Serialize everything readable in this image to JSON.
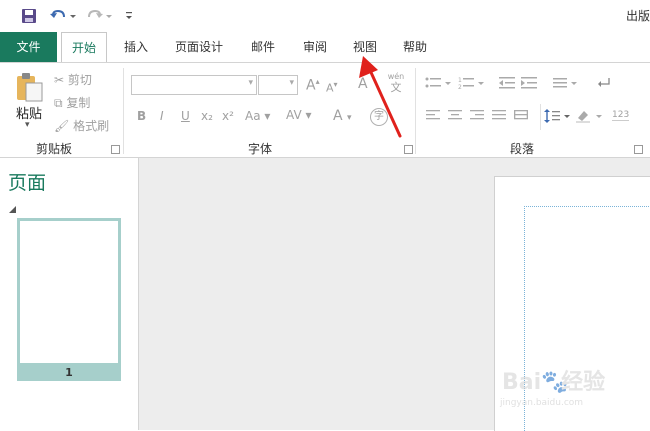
{
  "app": {
    "title_partial": "出版"
  },
  "quick_access": {
    "save_icon": "save-icon",
    "undo_icon": "undo-icon",
    "redo_icon": "redo-icon",
    "customize_icon": "customize-arrow-icon"
  },
  "tabs": [
    {
      "label": "文件"
    },
    {
      "label": "开始"
    },
    {
      "label": "插入"
    },
    {
      "label": "页面设计"
    },
    {
      "label": "邮件"
    },
    {
      "label": "审阅"
    },
    {
      "label": "视图"
    },
    {
      "label": "帮助"
    }
  ],
  "ribbon": {
    "clipboard": {
      "label": "剪贴板",
      "paste": "粘贴",
      "cut": "剪切",
      "copy": "复制",
      "format_painter": "格式刷"
    },
    "font": {
      "label": "字体",
      "bold": "B",
      "italic": "I",
      "underline": "U",
      "subscript": "x₂",
      "superscript": "x²",
      "change_case": "Aa",
      "spacing": "AV",
      "font_color": "A",
      "grow": "A",
      "shrink": "A",
      "phonetic_top": "wén",
      "phonetic_bottom": "文",
      "enclose": "字"
    },
    "paragraph": {
      "label": "段落",
      "numbering_sample": "123"
    }
  },
  "pages_panel": {
    "title": "页面",
    "page_number": "1"
  },
  "watermark": {
    "line1": "Bai",
    "line1b": "经验",
    "line2": "jingyan.baidu.com"
  },
  "colors": {
    "accent": "#1a7a5e",
    "thumb_frame": "#a6cfcb",
    "arrow": "#e0211c"
  }
}
